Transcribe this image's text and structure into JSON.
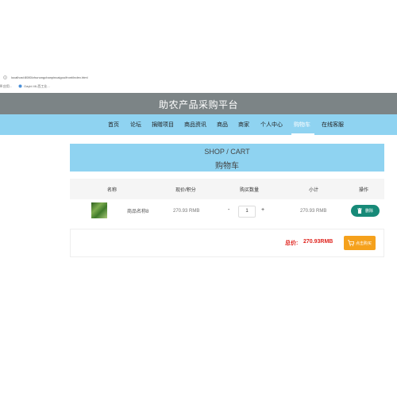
{
  "browser": {
    "url": "localhost:8080/zhunongchanpincaigou/front/index.html",
    "bookmark1": "Ⅲ 应用...",
    "bookmark2": "Oayld 46-西工业..."
  },
  "header": {
    "title": "助农产品采购平台"
  },
  "nav": {
    "items": [
      "首页",
      "论坛",
      "捐赠项目",
      "商品资讯",
      "商品",
      "商家",
      "个人中心",
      "购物车",
      "在线客服"
    ],
    "active_index": 7
  },
  "banner": {
    "en": "SHOP / CART",
    "cn": "购物车"
  },
  "table": {
    "headers": [
      "名称",
      "现价/积分",
      "购买数量",
      "小计",
      "操作"
    ],
    "rows": [
      {
        "name": "商品名称8",
        "price": "270.93 RMB",
        "minus": "-",
        "qty": "1",
        "plus": "+",
        "subtotal": "270.93 RMB",
        "delete_label": "删除"
      }
    ]
  },
  "summary": {
    "total_label": "总价:",
    "total_value": "270.93RMB",
    "checkout_label": "点击购买"
  },
  "colors": {
    "header_bg": "#7c8486",
    "nav_bg": "#8fd3f1",
    "delete_btn": "#178a78",
    "checkout_btn": "#f5a11c",
    "total": "#e0241e"
  }
}
